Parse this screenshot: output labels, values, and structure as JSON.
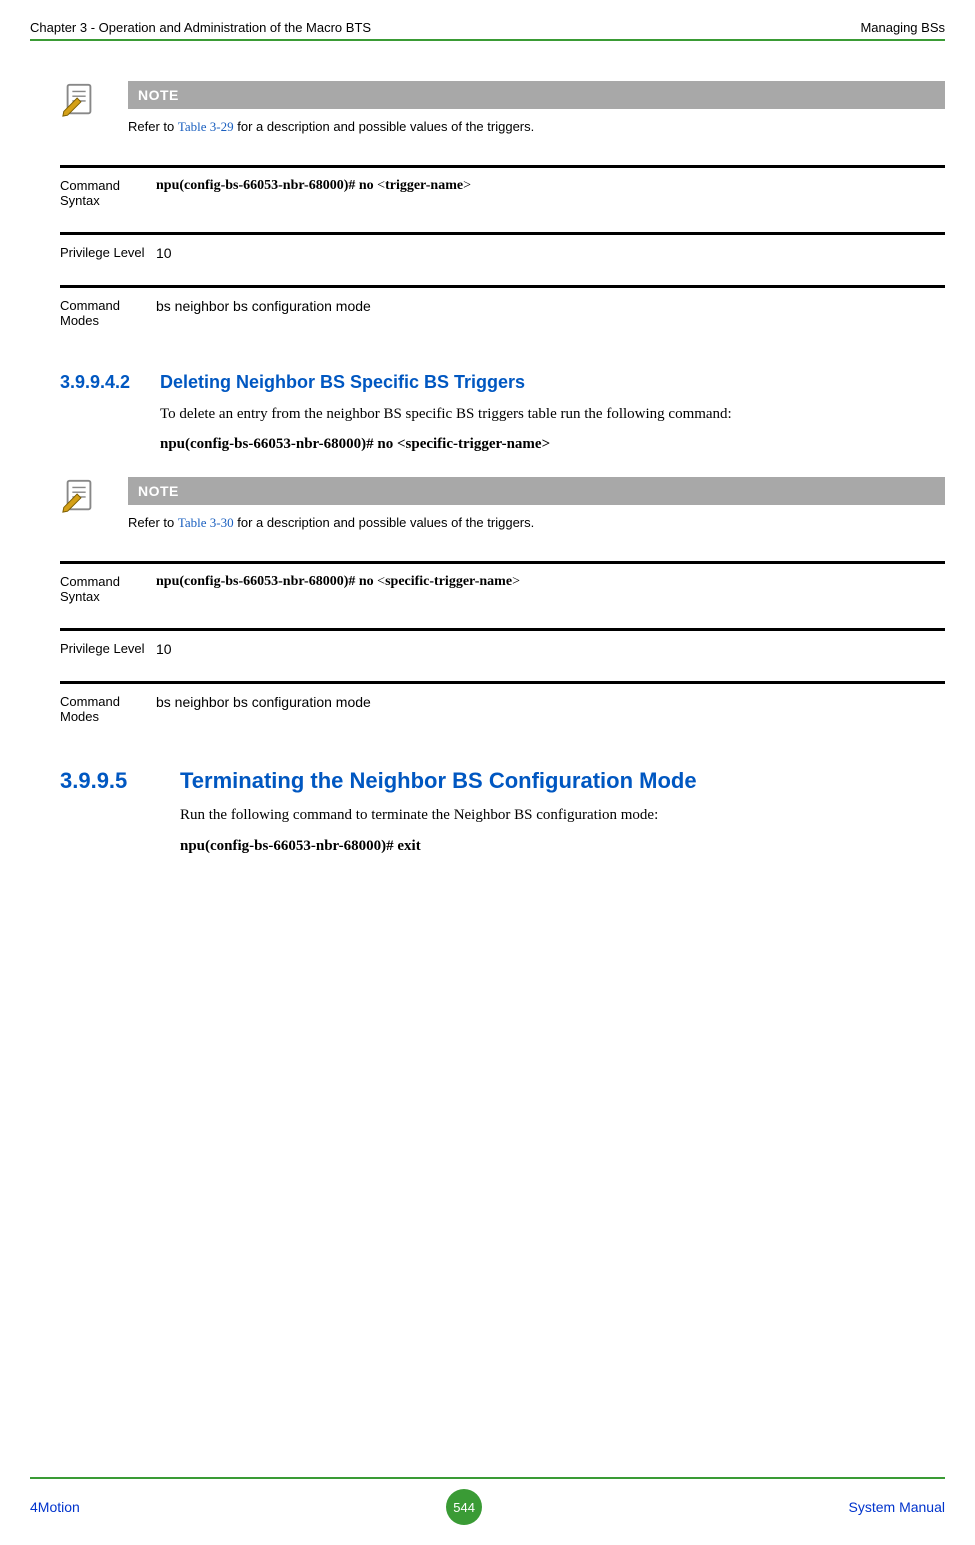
{
  "header": {
    "left": "Chapter 3 - Operation and Administration of the Macro BTS",
    "right": "Managing BSs"
  },
  "note1": {
    "label": "NOTE",
    "pre": "Refer to ",
    "link": "Table 3-29",
    "post": " for a description and possible values of the triggers."
  },
  "table1": {
    "syntaxLabel": "Command Syntax",
    "syntaxPrefix": "npu(config-bs-66053-nbr-68000)# no ",
    "syntaxLt": "<",
    "syntaxParam": "trigger-name",
    "syntaxGt": ">",
    "privLabel": "Privilege Level",
    "privValue": "10",
    "modesLabel": "Command Modes",
    "modesValue": "bs neighbor bs configuration mode"
  },
  "section1": {
    "num": "3.9.9.4.2",
    "title": "Deleting Neighbor BS Specific BS Triggers",
    "body": "To delete an entry from the neighbor BS specific BS triggers table run the following command:",
    "cmd": "npu(config-bs-66053-nbr-68000)# no <specific-trigger-name>"
  },
  "note2": {
    "label": "NOTE",
    "pre": "Refer to ",
    "link": "Table 3-30",
    "post": " for a description and possible values of the triggers."
  },
  "table2": {
    "syntaxLabel": "Command Syntax",
    "syntaxPrefix": "npu(config-bs-66053-nbr-68000)# no ",
    "syntaxLt": "<",
    "syntaxParam": "specific-trigger-name",
    "syntaxGt": ">",
    "privLabel": "Privilege Level",
    "privValue": "10",
    "modesLabel": "Command Modes",
    "modesValue": "bs neighbor bs configuration mode"
  },
  "section2": {
    "num": "3.9.9.5",
    "title": "Terminating the Neighbor BS Configuration Mode",
    "body": "Run the following command to terminate the Neighbor BS configuration mode:",
    "cmdPrefix": "npu(config-bs-66053-nbr-68000)",
    "cmdHash": "# ",
    "cmdWord": "exit"
  },
  "footer": {
    "left": "4Motion",
    "center": "544",
    "right": "System Manual"
  }
}
